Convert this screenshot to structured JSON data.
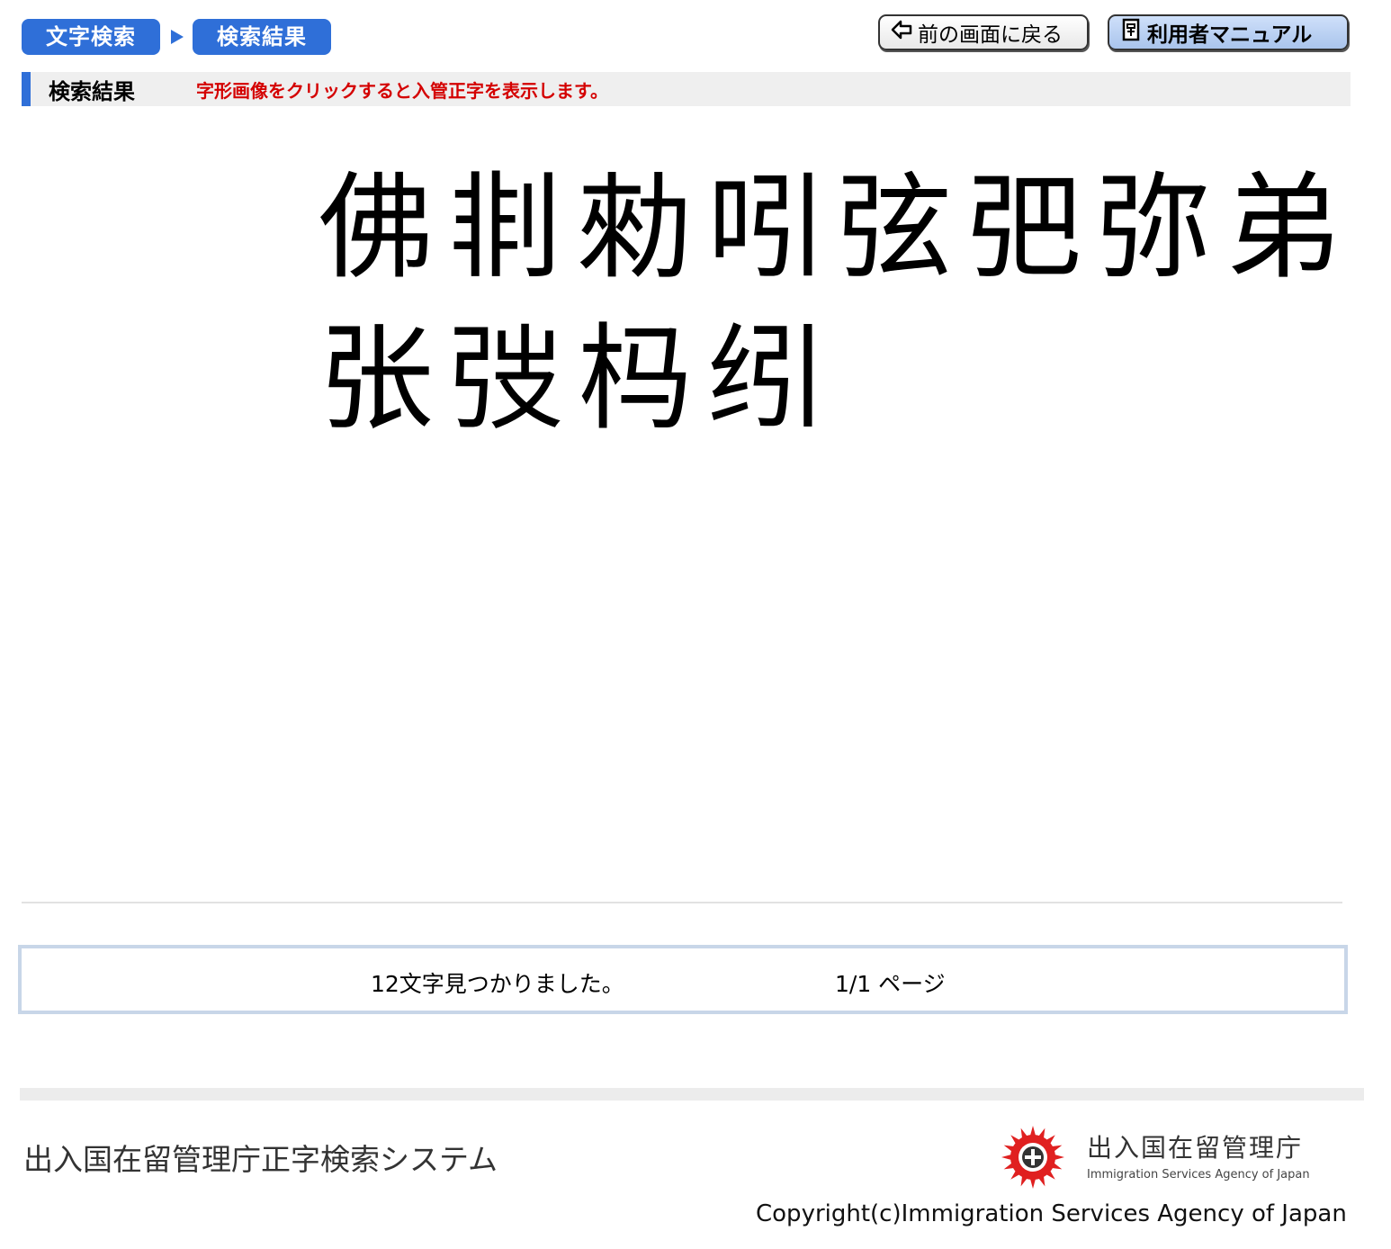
{
  "breadcrumb": {
    "step1": "文字検索",
    "step2": "検索結果"
  },
  "toolbar": {
    "back_label": "前の画面に戻る",
    "manual_label": "利用者マニュアル"
  },
  "section": {
    "title": "検索結果",
    "note": "字形画像をクリックすると入管正字を表示します。"
  },
  "results": {
    "row1": [
      "佛",
      "剕",
      "勑",
      "吲",
      "弦",
      "弝",
      "弥",
      "弟"
    ],
    "row2": [
      "张",
      "弢",
      "杩",
      "纼"
    ]
  },
  "summary": {
    "count_text": "12文字見つかりました。",
    "page_text": "1/1 ページ"
  },
  "footer": {
    "system_name": "出入国在留管理庁正字検索システム",
    "agency_name": "出入国在留管理庁",
    "agency_name_en": "Immigration Services Agency of Japan",
    "copyright": "Copyright(c)Immigration Services Agency of Japan"
  },
  "colors": {
    "accent": "#2f6fd8",
    "note_red": "#d40000"
  },
  "icons": {
    "back": "arrow-left-icon",
    "manual": "manual-book-icon",
    "logo": "agency-emblem-icon"
  }
}
